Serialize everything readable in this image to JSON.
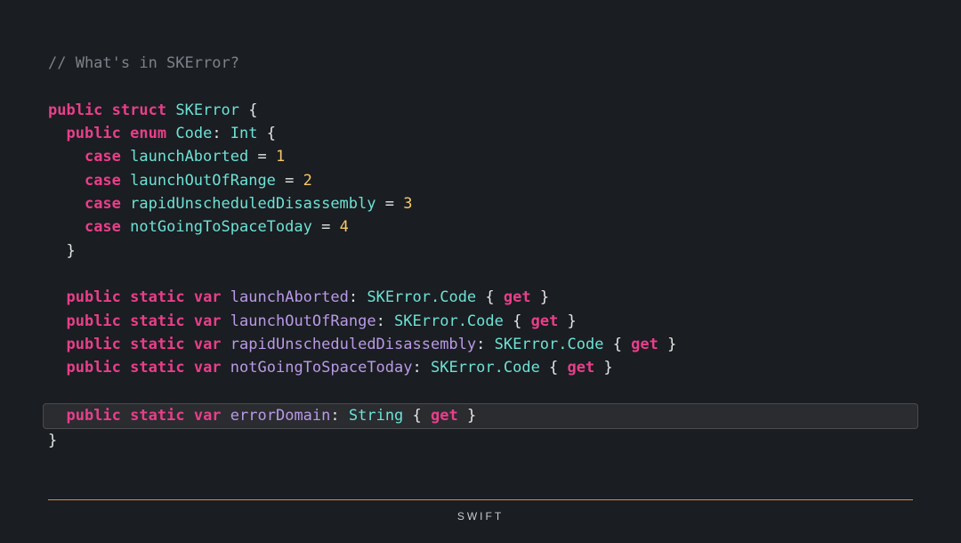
{
  "comment": "// What's in SKError?",
  "kw": {
    "public": "public",
    "struct": "struct",
    "enum": "enum",
    "case": "case",
    "static": "static",
    "var": "var",
    "get": "get"
  },
  "types": {
    "SKError": "SKError",
    "Code": "Code",
    "Int": "Int",
    "SKErrorCode": "SKError.Code",
    "String": "String"
  },
  "cases": [
    {
      "name": "launchAborted",
      "value": "1"
    },
    {
      "name": "launchOutOfRange",
      "value": "2"
    },
    {
      "name": "rapidUnscheduledDisassembly",
      "value": "3"
    },
    {
      "name": "notGoingToSpaceToday",
      "value": "4"
    }
  ],
  "statics": [
    {
      "name": "launchAborted"
    },
    {
      "name": "launchOutOfRange"
    },
    {
      "name": "rapidUnscheduledDisassembly"
    },
    {
      "name": "notGoingToSpaceToday"
    }
  ],
  "errorDomain": {
    "name": "errorDomain"
  },
  "footer": "SWIFT"
}
